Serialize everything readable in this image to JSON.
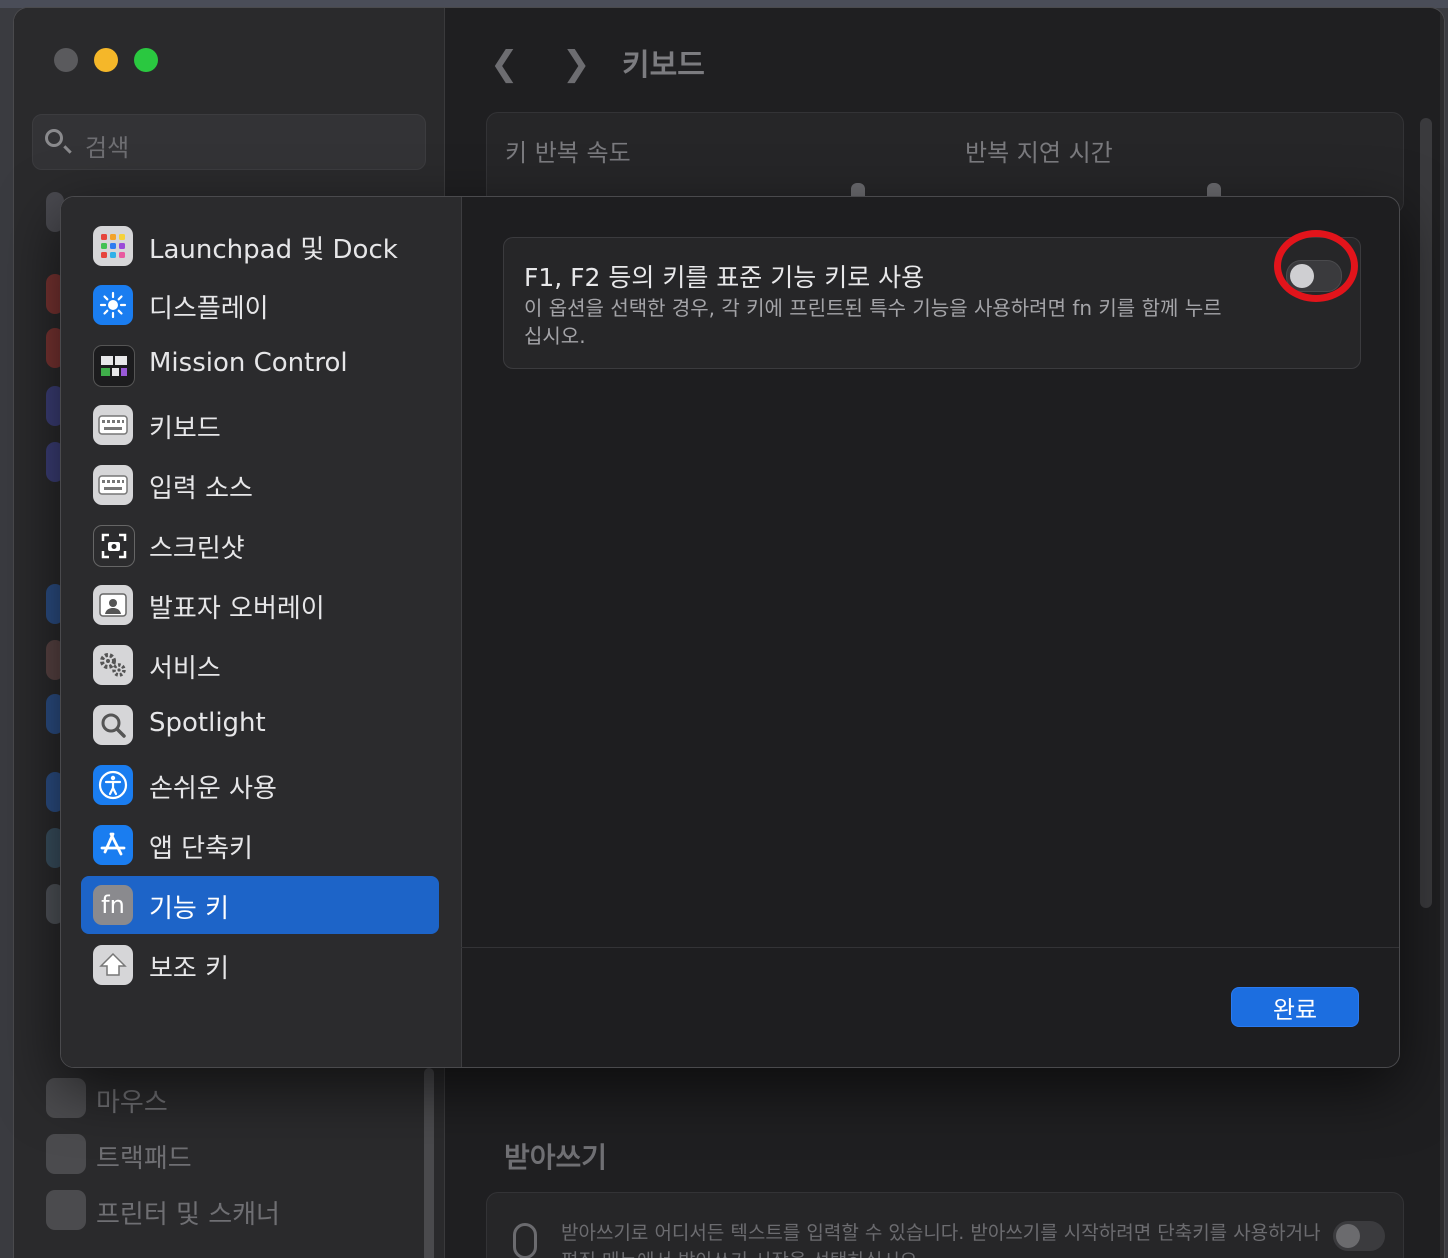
{
  "window": {
    "title": "키보드"
  },
  "background_sidebar": {
    "search_placeholder": "검색",
    "items": [
      {
        "label": "마우스",
        "icon": "mouse-icon"
      },
      {
        "label": "트랙패드",
        "icon": "trackpad-icon"
      },
      {
        "label": "프린터 및 스캐너",
        "icon": "printer-icon"
      }
    ]
  },
  "background_content": {
    "key_repeat_label": "키 반복 속도",
    "repeat_delay_label": "반복 지연 시간",
    "dictation_title": "받아쓰기",
    "dictation_desc": "받아쓰기로 어디서든 텍스트를 입력할 수 있습니다. 받아쓰기를 시작하려면 단축키를 사용하거나 편집 메뉴에서 받아쓰기 시작을 선택하십시오."
  },
  "modal": {
    "sidebar_items": [
      {
        "label": "Launchpad 및 Dock",
        "icon": "launchpad-icon",
        "color": "#d6d6d8"
      },
      {
        "label": "디스플레이",
        "icon": "display-brightness-icon",
        "color": "#1a7df0"
      },
      {
        "label": "Mission Control",
        "icon": "mission-control-icon",
        "color": "#1c1c1e"
      },
      {
        "label": "키보드",
        "icon": "keyboard-icon",
        "color": "#d6d6d8"
      },
      {
        "label": "입력 소스",
        "icon": "input-source-icon",
        "color": "#d6d6d8"
      },
      {
        "label": "스크린샷",
        "icon": "screenshot-icon",
        "color": "#2c2c2e"
      },
      {
        "label": "발표자 오버레이",
        "icon": "presenter-overlay-icon",
        "color": "#d6d6d8"
      },
      {
        "label": "서비스",
        "icon": "services-gear-icon",
        "color": "#d6d6d8"
      },
      {
        "label": "Spotlight",
        "icon": "spotlight-icon",
        "color": "#d6d6d8"
      },
      {
        "label": "손쉬운 사용",
        "icon": "accessibility-icon",
        "color": "#1a7df0"
      },
      {
        "label": "앱 단축키",
        "icon": "app-store-icon",
        "color": "#1a7df0"
      },
      {
        "label": "기능 키",
        "icon": "fn-key-icon",
        "color": "#8a8a8e",
        "glyph": "fn",
        "selected": true
      },
      {
        "label": "보조 키",
        "icon": "modifier-key-icon",
        "color": "#d6d6d8"
      }
    ],
    "option": {
      "title": "F1, F2 등의 키를 표준 기능 키로 사용",
      "description": "이 옵션을 선택한 경우, 각 키에 프린트된 특수 기능을 사용하려면 fn 키를 함께 누르십시오.",
      "enabled": false
    },
    "done_label": "완료"
  },
  "colors": {
    "accent": "#1d64c8",
    "annotation": "#e2141b"
  }
}
